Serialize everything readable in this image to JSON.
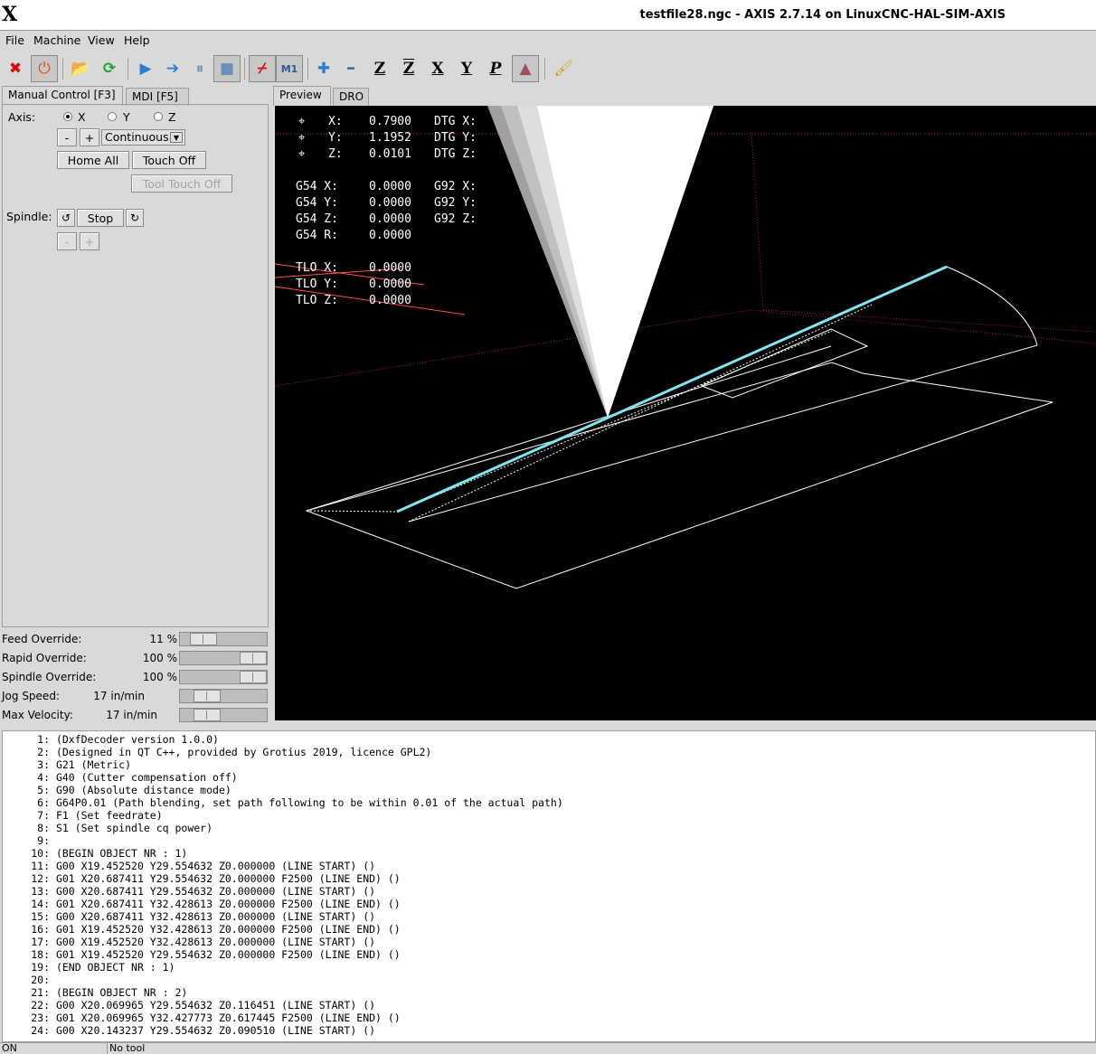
{
  "window": {
    "title": "testfile28.ngc - AXIS 2.7.14 on LinuxCNC-HAL-SIM-AXIS",
    "logo": "X"
  },
  "menu": [
    "File",
    "Machine",
    "View",
    "Help"
  ],
  "toolbar": [
    {
      "icon": "estop-icon",
      "glyph": "✖"
    },
    {
      "icon": "power-icon",
      "glyph": "⏻"
    },
    {
      "icon": "open-file-icon",
      "glyph": "📂"
    },
    {
      "icon": "reload-icon",
      "glyph": "⟳"
    },
    {
      "icon": "run-icon",
      "glyph": "▶"
    },
    {
      "icon": "step-icon",
      "glyph": "➔"
    },
    {
      "icon": "pause-icon",
      "glyph": "⏸"
    },
    {
      "icon": "stop-icon",
      "glyph": "■"
    },
    {
      "icon": "block-delete-icon",
      "glyph": "⌿"
    },
    {
      "icon": "optional-stop-icon",
      "glyph": "M1"
    },
    {
      "icon": "zoom-in-icon",
      "glyph": "✚"
    },
    {
      "icon": "zoom-out-icon",
      "glyph": "━"
    },
    {
      "icon": "view-z-icon",
      "glyph": "Z"
    },
    {
      "icon": "view-z2-icon",
      "glyph": "Z"
    },
    {
      "icon": "view-x-icon",
      "glyph": "X"
    },
    {
      "icon": "view-y-icon",
      "glyph": "Y"
    },
    {
      "icon": "view-p-icon",
      "glyph": "P"
    },
    {
      "icon": "tool-cone-icon",
      "glyph": "▲"
    },
    {
      "icon": "clear-plot-icon",
      "glyph": "🖌"
    }
  ],
  "left_tabs": [
    "Manual Control [F3]",
    "MDI [F5]"
  ],
  "manual": {
    "axis_label": "Axis:",
    "axes": [
      "X",
      "Y",
      "Z"
    ],
    "selected_axis": "X",
    "jog_minus": "-",
    "jog_plus": "+",
    "jog_mode": "Continuous",
    "home_all": "Home All",
    "touch_off": "Touch Off",
    "tool_touch_off": "Tool Touch Off",
    "spindle_label": "Spindle:",
    "spindle_stop": "Stop",
    "spindle_minus": "-",
    "spindle_plus": "+"
  },
  "overrides": [
    {
      "name": "Feed Override:",
      "value": "11 %",
      "fraction": 0.11
    },
    {
      "name": "Rapid Override:",
      "value": "100 %",
      "fraction": 1.0
    },
    {
      "name": "Spindle Override:",
      "value": "100 %",
      "fraction": 1.0
    },
    {
      "name": "Jog Speed:",
      "value": "17 in/min",
      "fraction": 0.17
    },
    {
      "name": "Max Velocity:",
      "value": "17 in/min",
      "fraction": 0.17
    }
  ],
  "right_tabs": [
    "Preview",
    "DRO"
  ],
  "dro": {
    "rows": [
      {
        "label": "X:",
        "value": "0.7900",
        "dtg": "DTG X:"
      },
      {
        "label": "Y:",
        "value": "1.1952",
        "dtg": "DTG Y:"
      },
      {
        "label": "Z:",
        "value": "0.0101",
        "dtg": "DTG Z:"
      }
    ],
    "g54": [
      {
        "label": "G54 X:",
        "value": "0.0000",
        "g92": "G92 X:"
      },
      {
        "label": "G54 Y:",
        "value": "0.0000",
        "g92": "G92 Y:"
      },
      {
        "label": "G54 Z:",
        "value": "0.0000",
        "g92": "G92 Z:"
      },
      {
        "label": "G54 R:",
        "value": "0.0000",
        "g92": ""
      }
    ],
    "tlo": [
      {
        "label": "TLO X:",
        "value": "0.0000"
      },
      {
        "label": "TLO Y:",
        "value": "0.0000"
      },
      {
        "label": "TLO Z:",
        "value": "0.0000"
      }
    ]
  },
  "colors": {
    "toolpath_traverse": "#ffffff",
    "toolpath_highlight": "#7fe5f0",
    "limits": "#b02020",
    "origin": "#ff5050"
  },
  "gcode": [
    {
      "n": "1:",
      "text": "(DxfDecoder version 1.0.0)"
    },
    {
      "n": "2:",
      "text": "(Designed in QT C++, provided by Grotius 2019, licence GPL2)"
    },
    {
      "n": "3:",
      "text": "G21 (Metric)"
    },
    {
      "n": "4:",
      "text": "G40 (Cutter compensation off)"
    },
    {
      "n": "5:",
      "text": "G90 (Absolute distance mode)"
    },
    {
      "n": "6:",
      "text": "G64P0.01 (Path blending, set path following to be within 0.01 of the actual path)"
    },
    {
      "n": "7:",
      "text": "F1 (Set feedrate)"
    },
    {
      "n": "8:",
      "text": "S1 (Set spindle cq power)"
    },
    {
      "n": "9:",
      "text": ""
    },
    {
      "n": "10:",
      "text": "(BEGIN OBJECT NR : 1)"
    },
    {
      "n": "11:",
      "text": "G00 X19.452520 Y29.554632 Z0.000000 (LINE START) ()"
    },
    {
      "n": "12:",
      "text": "G01 X20.687411 Y29.554632 Z0.000000 F2500 (LINE END) ()"
    },
    {
      "n": "13:",
      "text": "G00 X20.687411 Y29.554632 Z0.000000 (LINE START) ()"
    },
    {
      "n": "14:",
      "text": "G01 X20.687411 Y32.428613 Z0.000000 F2500 (LINE END) ()"
    },
    {
      "n": "15:",
      "text": "G00 X20.687411 Y32.428613 Z0.000000 (LINE START) ()"
    },
    {
      "n": "16:",
      "text": "G01 X19.452520 Y32.428613 Z0.000000 F2500 (LINE END) ()"
    },
    {
      "n": "17:",
      "text": "G00 X19.452520 Y32.428613 Z0.000000 (LINE START) ()"
    },
    {
      "n": "18:",
      "text": "G01 X19.452520 Y29.554632 Z0.000000 F2500 (LINE END) ()"
    },
    {
      "n": "19:",
      "text": "(END OBJECT NR : 1)"
    },
    {
      "n": "20:",
      "text": ""
    },
    {
      "n": "21:",
      "text": "(BEGIN OBJECT NR : 2)"
    },
    {
      "n": "22:",
      "text": "G00 X20.069965 Y29.554632 Z0.116451 (LINE START) ()"
    },
    {
      "n": "23:",
      "text": "G01 X20.069965 Y32.427773 Z0.617445 F2500 (LINE END) ()"
    },
    {
      "n": "24:",
      "text": "G00 X20.143237 Y29.554632 Z0.090510 (LINE START) ()"
    }
  ],
  "status": {
    "machine": "ON",
    "tool": "No tool"
  }
}
